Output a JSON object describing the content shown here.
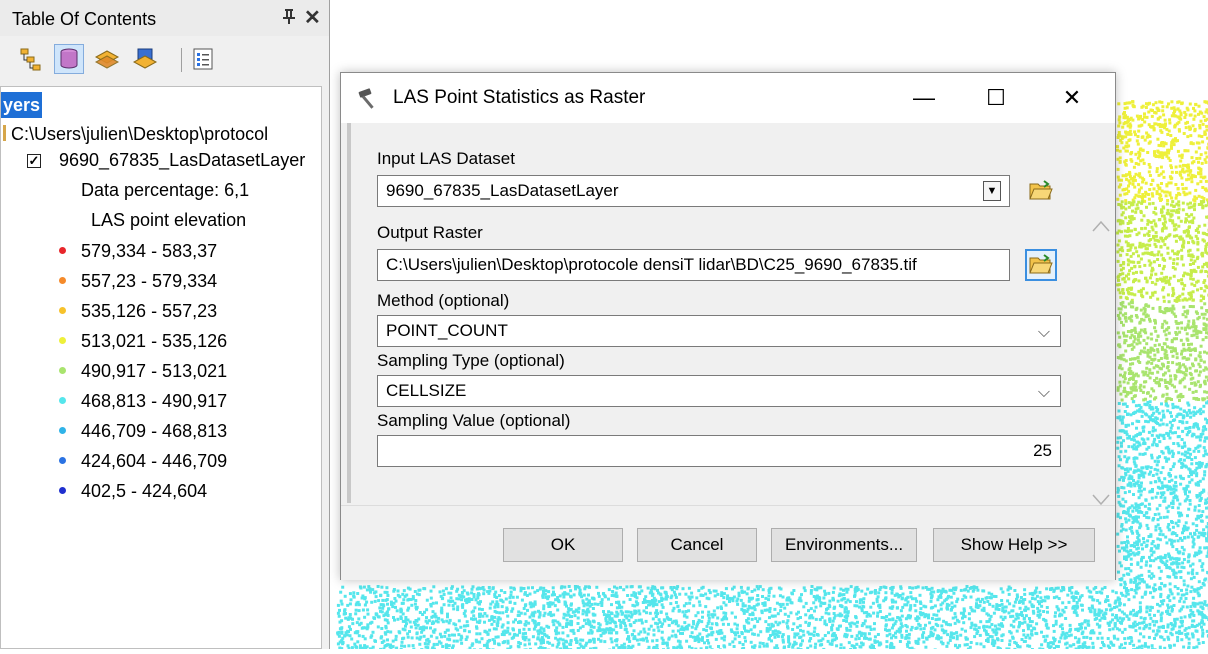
{
  "toc": {
    "title": "Table Of Contents",
    "pin_icon": "pin-icon",
    "close_glyph": "✕",
    "toolbar": [
      "list-by-drawing-order-icon",
      "list-by-source-icon",
      "list-by-visibility-icon",
      "list-by-selection-icon",
      "options-icon"
    ],
    "tree": {
      "root_label": "yers",
      "path": "C:\\Users\\julien\\Desktop\\protocol",
      "layer_name": "9690_67835_LasDatasetLayer",
      "layer_checked": true,
      "data_percentage": "Data percentage: 6,1",
      "elevation_label": "LAS point elevation",
      "legend": [
        {
          "label": "579,334 - 583,37",
          "color": "#e8262b"
        },
        {
          "label": "557,23 - 579,334",
          "color": "#f58a2a"
        },
        {
          "label": "535,126 - 557,23",
          "color": "#f7c22b"
        },
        {
          "label": "513,021 - 535,126",
          "color": "#eef03a"
        },
        {
          "label": "490,917 - 513,021",
          "color": "#a9e46e"
        },
        {
          "label": "468,813 - 490,917",
          "color": "#55e6ec"
        },
        {
          "label": "446,709 - 468,813",
          "color": "#2fb3e8"
        },
        {
          "label": "424,604 - 446,709",
          "color": "#2a72e3"
        },
        {
          "label": "402,5 - 424,604",
          "color": "#1f2fcf"
        }
      ]
    }
  },
  "map": {
    "point_colors": [
      "#eef03a",
      "#c6ed4a",
      "#a9e46e",
      "#55e6ec"
    ]
  },
  "dialog": {
    "title": "LAS Point Statistics as Raster",
    "minimize": "—",
    "maximize": "☐",
    "close": "✕",
    "input_las": {
      "label": "Input LAS Dataset",
      "value": "9690_67835_LasDatasetLayer"
    },
    "output_raster": {
      "label": "Output Raster",
      "value": "C:\\Users\\julien\\Desktop\\protocole densiT lidar\\BD\\C25_9690_67835.tif"
    },
    "method": {
      "label": "Method (optional)",
      "value": "POINT_COUNT"
    },
    "sampling_type": {
      "label": "Sampling Type (optional)",
      "value": "CELLSIZE"
    },
    "sampling_value": {
      "label": "Sampling Value (optional)",
      "value": "25"
    },
    "buttons": {
      "ok": "OK",
      "cancel": "Cancel",
      "environments": "Environments...",
      "show_help": "Show Help >>"
    }
  }
}
